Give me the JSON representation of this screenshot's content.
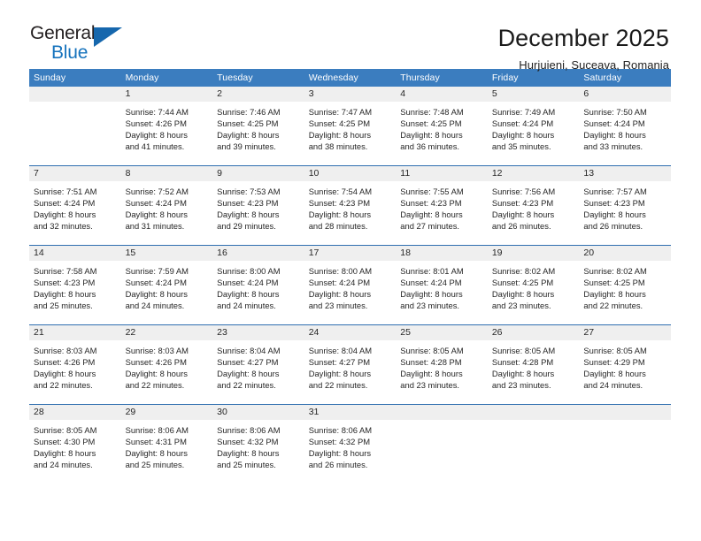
{
  "logo": {
    "word1": "General",
    "word2": "Blue",
    "triangle_color": "#1667ad"
  },
  "header": {
    "title": "December 2025",
    "subtitle": "Hurjuieni, Suceava, Romania"
  },
  "theme": {
    "header_row_bg": "#3b7dbf",
    "daynum_band_bg": "#efefef",
    "week_divider": "#2f6fb0",
    "text": "#262626"
  },
  "weekdays": [
    "Sunday",
    "Monday",
    "Tuesday",
    "Wednesday",
    "Thursday",
    "Friday",
    "Saturday"
  ],
  "weeks": [
    {
      "days": [
        {
          "num": "",
          "lines": [
            "",
            "",
            "",
            ""
          ]
        },
        {
          "num": "1",
          "lines": [
            "Sunrise: 7:44 AM",
            "Sunset: 4:26 PM",
            "Daylight: 8 hours",
            "and 41 minutes."
          ]
        },
        {
          "num": "2",
          "lines": [
            "Sunrise: 7:46 AM",
            "Sunset: 4:25 PM",
            "Daylight: 8 hours",
            "and 39 minutes."
          ]
        },
        {
          "num": "3",
          "lines": [
            "Sunrise: 7:47 AM",
            "Sunset: 4:25 PM",
            "Daylight: 8 hours",
            "and 38 minutes."
          ]
        },
        {
          "num": "4",
          "lines": [
            "Sunrise: 7:48 AM",
            "Sunset: 4:25 PM",
            "Daylight: 8 hours",
            "and 36 minutes."
          ]
        },
        {
          "num": "5",
          "lines": [
            "Sunrise: 7:49 AM",
            "Sunset: 4:24 PM",
            "Daylight: 8 hours",
            "and 35 minutes."
          ]
        },
        {
          "num": "6",
          "lines": [
            "Sunrise: 7:50 AM",
            "Sunset: 4:24 PM",
            "Daylight: 8 hours",
            "and 33 minutes."
          ]
        }
      ]
    },
    {
      "days": [
        {
          "num": "7",
          "lines": [
            "Sunrise: 7:51 AM",
            "Sunset: 4:24 PM",
            "Daylight: 8 hours",
            "and 32 minutes."
          ]
        },
        {
          "num": "8",
          "lines": [
            "Sunrise: 7:52 AM",
            "Sunset: 4:24 PM",
            "Daylight: 8 hours",
            "and 31 minutes."
          ]
        },
        {
          "num": "9",
          "lines": [
            "Sunrise: 7:53 AM",
            "Sunset: 4:23 PM",
            "Daylight: 8 hours",
            "and 29 minutes."
          ]
        },
        {
          "num": "10",
          "lines": [
            "Sunrise: 7:54 AM",
            "Sunset: 4:23 PM",
            "Daylight: 8 hours",
            "and 28 minutes."
          ]
        },
        {
          "num": "11",
          "lines": [
            "Sunrise: 7:55 AM",
            "Sunset: 4:23 PM",
            "Daylight: 8 hours",
            "and 27 minutes."
          ]
        },
        {
          "num": "12",
          "lines": [
            "Sunrise: 7:56 AM",
            "Sunset: 4:23 PM",
            "Daylight: 8 hours",
            "and 26 minutes."
          ]
        },
        {
          "num": "13",
          "lines": [
            "Sunrise: 7:57 AM",
            "Sunset: 4:23 PM",
            "Daylight: 8 hours",
            "and 26 minutes."
          ]
        }
      ]
    },
    {
      "days": [
        {
          "num": "14",
          "lines": [
            "Sunrise: 7:58 AM",
            "Sunset: 4:23 PM",
            "Daylight: 8 hours",
            "and 25 minutes."
          ]
        },
        {
          "num": "15",
          "lines": [
            "Sunrise: 7:59 AM",
            "Sunset: 4:24 PM",
            "Daylight: 8 hours",
            "and 24 minutes."
          ]
        },
        {
          "num": "16",
          "lines": [
            "Sunrise: 8:00 AM",
            "Sunset: 4:24 PM",
            "Daylight: 8 hours",
            "and 24 minutes."
          ]
        },
        {
          "num": "17",
          "lines": [
            "Sunrise: 8:00 AM",
            "Sunset: 4:24 PM",
            "Daylight: 8 hours",
            "and 23 minutes."
          ]
        },
        {
          "num": "18",
          "lines": [
            "Sunrise: 8:01 AM",
            "Sunset: 4:24 PM",
            "Daylight: 8 hours",
            "and 23 minutes."
          ]
        },
        {
          "num": "19",
          "lines": [
            "Sunrise: 8:02 AM",
            "Sunset: 4:25 PM",
            "Daylight: 8 hours",
            "and 23 minutes."
          ]
        },
        {
          "num": "20",
          "lines": [
            "Sunrise: 8:02 AM",
            "Sunset: 4:25 PM",
            "Daylight: 8 hours",
            "and 22 minutes."
          ]
        }
      ]
    },
    {
      "days": [
        {
          "num": "21",
          "lines": [
            "Sunrise: 8:03 AM",
            "Sunset: 4:26 PM",
            "Daylight: 8 hours",
            "and 22 minutes."
          ]
        },
        {
          "num": "22",
          "lines": [
            "Sunrise: 8:03 AM",
            "Sunset: 4:26 PM",
            "Daylight: 8 hours",
            "and 22 minutes."
          ]
        },
        {
          "num": "23",
          "lines": [
            "Sunrise: 8:04 AM",
            "Sunset: 4:27 PM",
            "Daylight: 8 hours",
            "and 22 minutes."
          ]
        },
        {
          "num": "24",
          "lines": [
            "Sunrise: 8:04 AM",
            "Sunset: 4:27 PM",
            "Daylight: 8 hours",
            "and 22 minutes."
          ]
        },
        {
          "num": "25",
          "lines": [
            "Sunrise: 8:05 AM",
            "Sunset: 4:28 PM",
            "Daylight: 8 hours",
            "and 23 minutes."
          ]
        },
        {
          "num": "26",
          "lines": [
            "Sunrise: 8:05 AM",
            "Sunset: 4:28 PM",
            "Daylight: 8 hours",
            "and 23 minutes."
          ]
        },
        {
          "num": "27",
          "lines": [
            "Sunrise: 8:05 AM",
            "Sunset: 4:29 PM",
            "Daylight: 8 hours",
            "and 24 minutes."
          ]
        }
      ]
    },
    {
      "days": [
        {
          "num": "28",
          "lines": [
            "Sunrise: 8:05 AM",
            "Sunset: 4:30 PM",
            "Daylight: 8 hours",
            "and 24 minutes."
          ]
        },
        {
          "num": "29",
          "lines": [
            "Sunrise: 8:06 AM",
            "Sunset: 4:31 PM",
            "Daylight: 8 hours",
            "and 25 minutes."
          ]
        },
        {
          "num": "30",
          "lines": [
            "Sunrise: 8:06 AM",
            "Sunset: 4:32 PM",
            "Daylight: 8 hours",
            "and 25 minutes."
          ]
        },
        {
          "num": "31",
          "lines": [
            "Sunrise: 8:06 AM",
            "Sunset: 4:32 PM",
            "Daylight: 8 hours",
            "and 26 minutes."
          ]
        },
        {
          "num": "",
          "lines": [
            "",
            "",
            "",
            ""
          ]
        },
        {
          "num": "",
          "lines": [
            "",
            "",
            "",
            ""
          ]
        },
        {
          "num": "",
          "lines": [
            "",
            "",
            "",
            ""
          ]
        }
      ]
    }
  ]
}
